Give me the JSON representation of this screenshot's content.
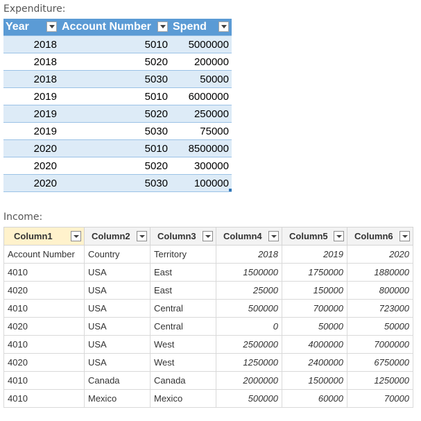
{
  "expenditure": {
    "label": "Expenditure:",
    "headers": [
      "Year",
      "Account Number",
      "Spend"
    ],
    "rows": [
      [
        "2018",
        "5010",
        "5000000"
      ],
      [
        "2018",
        "5020",
        "200000"
      ],
      [
        "2018",
        "5030",
        "50000"
      ],
      [
        "2019",
        "5010",
        "6000000"
      ],
      [
        "2019",
        "5020",
        "250000"
      ],
      [
        "2019",
        "5030",
        "75000"
      ],
      [
        "2020",
        "5010",
        "8500000"
      ],
      [
        "2020",
        "5020",
        "300000"
      ],
      [
        "2020",
        "5030",
        "100000"
      ]
    ],
    "colors": {
      "header": "#5b9bd5",
      "band": "#ddebf7"
    }
  },
  "income": {
    "label": "Income:",
    "headers": [
      "Column1",
      "Column2",
      "Column3",
      "Column4",
      "Column5",
      "Column6"
    ],
    "rows": [
      [
        "Account Number",
        "Country",
        "Territory",
        "2018",
        "2019",
        "2020"
      ],
      [
        "4010",
        "USA",
        "East",
        "1500000",
        "1750000",
        "1880000"
      ],
      [
        "4020",
        "USA",
        "East",
        "25000",
        "150000",
        "800000"
      ],
      [
        "4010",
        "USA",
        "Central",
        "500000",
        "700000",
        "723000"
      ],
      [
        "4020",
        "USA",
        "Central",
        "0",
        "50000",
        "50000"
      ],
      [
        "4010",
        "USA",
        "West",
        "2500000",
        "4000000",
        "7000000"
      ],
      [
        "4020",
        "USA",
        "West",
        "1250000",
        "2400000",
        "6750000"
      ],
      [
        "4010",
        "Canada",
        "Canada",
        "2000000",
        "1500000",
        "1250000"
      ],
      [
        "4010",
        "Mexico",
        "Mexico",
        "500000",
        "60000",
        "70000"
      ]
    ],
    "colors": {
      "selected_header": "#fff2cc"
    }
  }
}
